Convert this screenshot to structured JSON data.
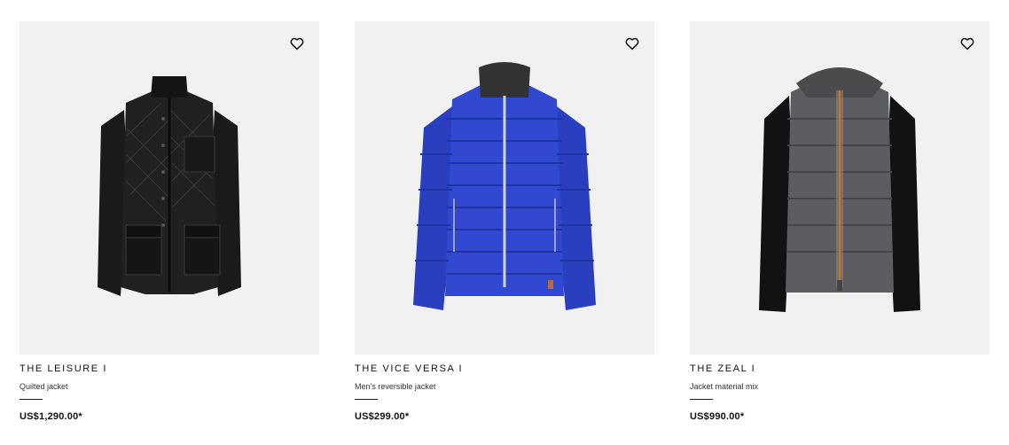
{
  "products": [
    {
      "title": "THE LEISURE I",
      "subtitle": "Quilted jacket",
      "price": "US$1,290.00*",
      "jacket_color": "#1b1b1b",
      "icon": "heart-outline-icon"
    },
    {
      "title": "THE VICE VERSA I",
      "subtitle": "Men’s reversible jacket",
      "price": "US$299.00*",
      "jacket_color": "#2f46c9",
      "icon": "heart-outline-icon"
    },
    {
      "title": "THE ZEAL I",
      "subtitle": "Jacket material mix",
      "price": "US$990.00*",
      "jacket_color": "#5a5b5d",
      "icon": "heart-outline-icon"
    }
  ],
  "colors": {
    "image_background": "#f1f1f2",
    "text": "#111111"
  }
}
